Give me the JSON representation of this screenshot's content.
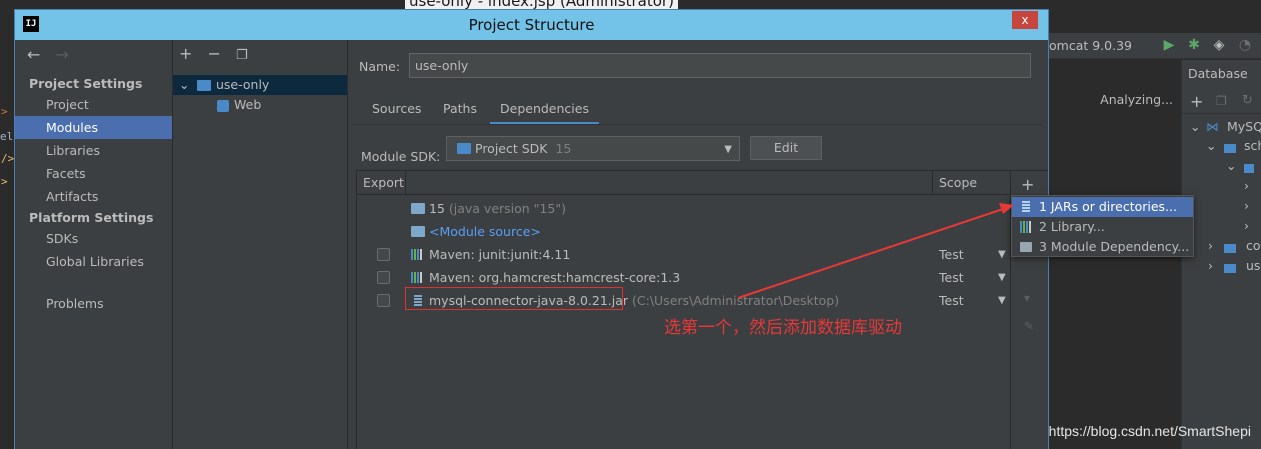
{
  "background_window": {
    "title": "use-only - index.jsp (Administrator)",
    "run_config": "omcat 9.0.39",
    "analyzing": "Analyzing...",
    "database_panel": {
      "title": "Database",
      "rows": [
        "MySQ",
        "sch",
        "",
        "",
        "",
        "co",
        "us"
      ]
    }
  },
  "dialog": {
    "title": "Project Structure",
    "close_label": "x",
    "app_icon_label": "IJ"
  },
  "nav": {
    "project_settings_header": "Project Settings",
    "project_settings_items": [
      "Project",
      "Modules",
      "Libraries",
      "Facets",
      "Artifacts"
    ],
    "selected": "Modules",
    "platform_settings_header": "Platform Settings",
    "platform_settings_items": [
      "SDKs",
      "Global Libraries"
    ],
    "problems": "Problems"
  },
  "tree": {
    "module": "use-only",
    "child": "Web"
  },
  "content": {
    "name_label": "Name:",
    "name_value": "use-only",
    "tabs": [
      "Sources",
      "Paths",
      "Dependencies"
    ],
    "active_tab": "Dependencies",
    "sdk_label": "Module SDK:",
    "sdk_value": "Project SDK",
    "sdk_version": "15",
    "edit_label": "Edit",
    "table_headers": {
      "export": "Export",
      "scope": "Scope"
    },
    "dependencies": [
      {
        "name": "15",
        "detail": "(java version \"15\")"
      },
      {
        "name": "<Module source>"
      },
      {
        "name": "Maven: junit:junit:4.11",
        "scope": "Test"
      },
      {
        "name": "Maven: org.hamcrest:hamcrest-core:1.3",
        "scope": "Test"
      },
      {
        "name": "mysql-connector-java-8.0.21.jar",
        "detail": "(C:\\Users\\Administrator\\Desktop)",
        "scope": "Test"
      }
    ]
  },
  "popup_menu": {
    "items": [
      "1  JARs or directories...",
      "2  Library...",
      "3  Module Dependency..."
    ],
    "selected_index": 0
  },
  "annotation": {
    "text": "选第一个，然后添加数据库驱动",
    "color": "#e83838"
  },
  "watermark": "https://blog.csdn.net/SmartShepi",
  "colors": {
    "selection": "#4b6eaf",
    "titlebar": "#73c3e8",
    "link": "#589df6",
    "annotation_red": "#e83838"
  }
}
